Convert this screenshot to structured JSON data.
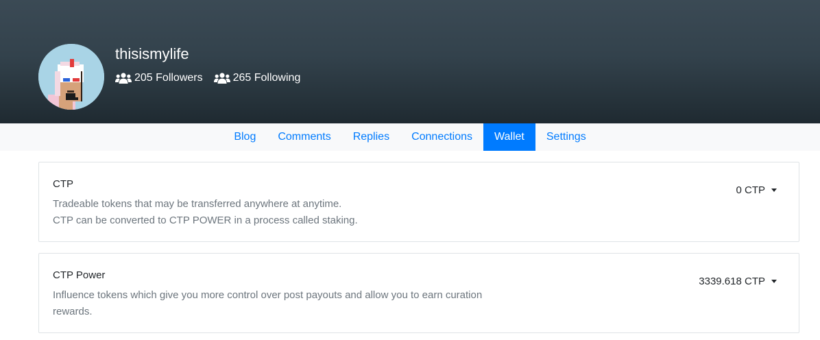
{
  "profile": {
    "username": "thisismylife",
    "followers_text": "205 Followers",
    "following_text": "265 Following"
  },
  "tabs": [
    {
      "label": "Blog",
      "active": false
    },
    {
      "label": "Comments",
      "active": false
    },
    {
      "label": "Replies",
      "active": false
    },
    {
      "label": "Connections",
      "active": false
    },
    {
      "label": "Wallet",
      "active": true
    },
    {
      "label": "Settings",
      "active": false
    }
  ],
  "wallet": {
    "ctp": {
      "title": "CTP",
      "desc_line1": "Tradeable tokens that may be transferred anywhere at anytime.",
      "desc_line2": "CTP can be converted to CTP POWER in a process called staking.",
      "amount": "0 CTP"
    },
    "ctp_power": {
      "title": "CTP Power",
      "desc_line1": "Influence tokens which give you more control over post payouts and allow you to earn curation",
      "desc_line2": "rewards.",
      "amount": "3339.618 CTP"
    }
  },
  "colors": {
    "accent": "#007bff",
    "header_top": "#3b4a55",
    "header_bottom": "#1f2a31",
    "muted_text": "#6c757d"
  },
  "icons": {
    "followers": "users-icon",
    "following": "users-icon",
    "dropdown": "caret-down-icon"
  }
}
